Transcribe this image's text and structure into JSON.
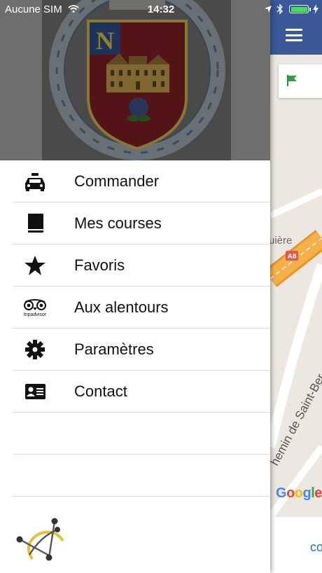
{
  "status_bar": {
    "carrier": "Aucune SIM",
    "time": "14:32"
  },
  "menu": {
    "items": [
      {
        "label": "Commander",
        "icon": "taxi-icon"
      },
      {
        "label": "Mes courses",
        "icon": "book-icon"
      },
      {
        "label": "Favoris",
        "icon": "star-icon"
      },
      {
        "label": "Aux alentours",
        "icon": "tripadvisor-icon",
        "icon_text": "tripadvisor"
      },
      {
        "label": "Paramètres",
        "icon": "gear-icon"
      },
      {
        "label": "Contact",
        "icon": "contact-card-icon"
      }
    ]
  },
  "map": {
    "map_labels": [
      "uière",
      "A8",
      "hemin de Saint-Ber"
    ],
    "google_logo": "Google",
    "bottom_label": "co"
  },
  "colors": {
    "navbar": "#3b5998",
    "header_overlay": "#6e6e6e",
    "highway": "#f4a33a",
    "battery": "#4cd964"
  }
}
